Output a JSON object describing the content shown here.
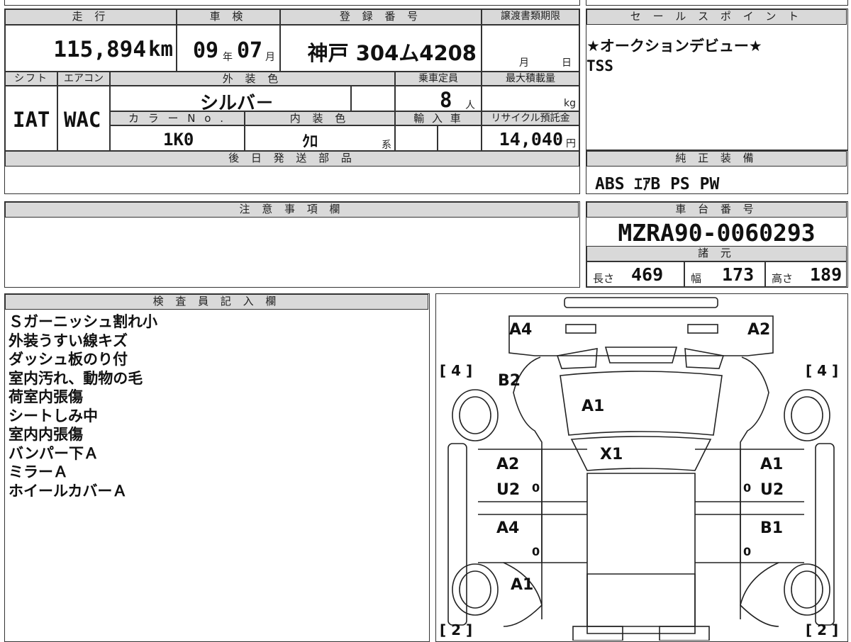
{
  "top": {
    "mileage_label": "走 行",
    "mileage_value": "115,894",
    "mileage_unit": "km",
    "inspection_label": "車 検",
    "inspection_year": "09",
    "inspection_year_unit": "年",
    "inspection_month": "07",
    "inspection_month_unit": "月",
    "registration_label": "登 録 番 号",
    "registration_value": "神戸 304ム4208",
    "transfer_label": "譲渡書類期限",
    "transfer_month": "月",
    "transfer_day": "日",
    "shift_label": "シフト",
    "shift_value": "IAT",
    "ac_label": "エアコン",
    "ac_value": "WAC",
    "exterior_label": "外 装 色",
    "exterior_value": "シルバ－",
    "capacity_label": "乗車定員",
    "capacity_value": "8",
    "capacity_unit": "人",
    "max_load_label": "最大積載量",
    "max_load_unit": "kg",
    "color_no_label": "カ ラ ー N o .",
    "color_no_value": "1K0",
    "interior_label": "内 装 色",
    "interior_value": "ｸﾛ",
    "interior_unit": "系",
    "import_label": "輸 入 車",
    "recycle_label": "リサイクル預託金",
    "recycle_value": "14,040",
    "recycle_unit": "円",
    "later_parts_label": "後 日 発 送 部 品"
  },
  "sales": {
    "label": "セ ー ル ス ポ イ ン ト",
    "line1": "★オークションデビュー★",
    "line2": "TSS"
  },
  "equipment": {
    "label": "純 正 装 備",
    "value": "ABS ｴｱB PS PW"
  },
  "caution": {
    "label": "注 意 事 項 欄"
  },
  "chassis": {
    "label": "車 台 番 号",
    "value": "MZRA90-0060293"
  },
  "specs": {
    "label": "諸 元",
    "length_label": "長さ",
    "length_value": "469",
    "width_label": "幅",
    "width_value": "173",
    "height_label": "高さ",
    "height_value": "189"
  },
  "inspector": {
    "label": "検 査 員 記 入 欄",
    "notes": [
      "Ｓガーニッシュ割れ小",
      "外装うすい線キズ",
      "ダッシュ板のり付",
      "室内汚れ、動物の毛",
      "荷室内張傷",
      "シートしみ中",
      "室内内張傷",
      "バンパー下Ａ",
      "ミラーＡ",
      "ホイールカバーＡ"
    ]
  },
  "diagram": {
    "tire_front_left": "[ 4 ]",
    "tire_front_right": "[ 4 ]",
    "tire_rear_left": "[ 2 ]",
    "tire_rear_right": "[ 2 ]",
    "marks": {
      "front_left_corner": "A4",
      "front_right_corner": "A2",
      "left_fender": "B2",
      "hood": "A1",
      "windshield": "X1",
      "left_front_door": "A2",
      "left_front_door_2": "U2",
      "left_rear_door": "A4",
      "right_front_door": "A1",
      "right_front_door_2": "U2",
      "right_rear_door": "B1",
      "left_rear_fender": "A1",
      "door_zero_1": "0",
      "door_zero_2": "0",
      "door_zero_3": "0",
      "door_zero_4": "0"
    }
  }
}
